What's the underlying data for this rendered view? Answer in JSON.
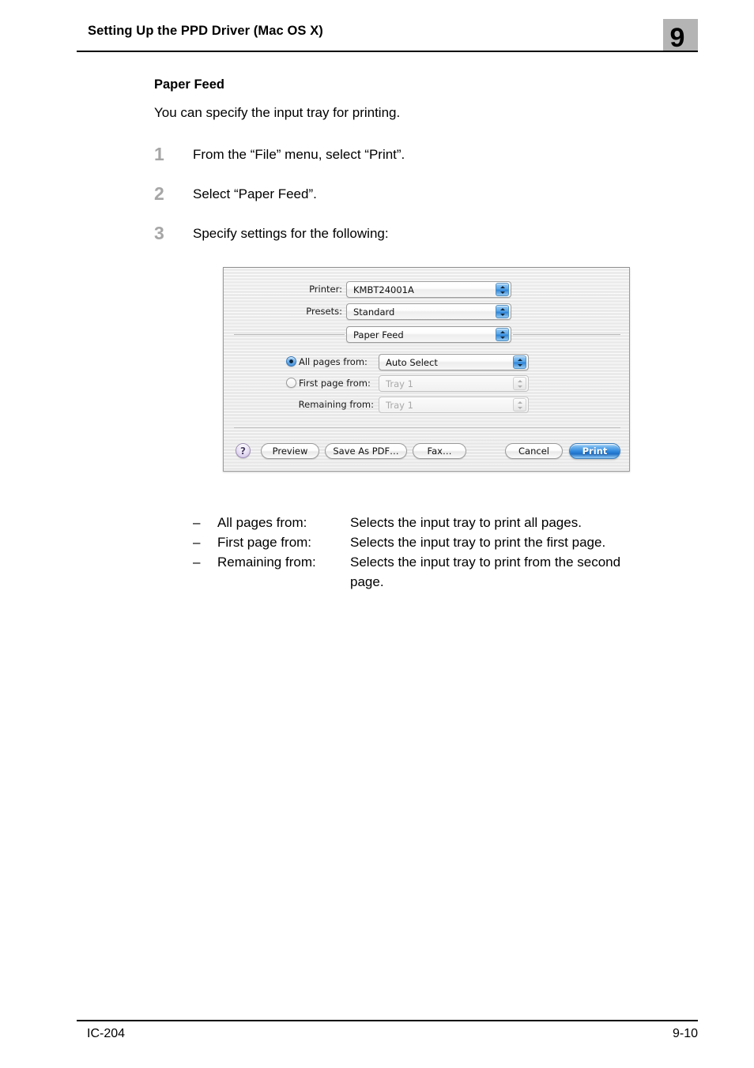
{
  "header": {
    "title": "Setting Up the PPD Driver (Mac OS X)",
    "chapter": "9"
  },
  "body": {
    "section_heading": "Paper Feed",
    "intro": "You can specify the input tray for printing.",
    "steps": [
      {
        "num": "1",
        "text": "From the “File” menu, select “Print”."
      },
      {
        "num": "2",
        "text": "Select “Paper Feed”."
      },
      {
        "num": "3",
        "text": "Specify settings for the following:"
      }
    ]
  },
  "dialog": {
    "printer_label": "Printer:",
    "printer_value": "KMBT24001A",
    "presets_label": "Presets:",
    "presets_value": "Standard",
    "pane_value": "Paper Feed",
    "all_pages_label": "All pages from:",
    "all_pages_value": "Auto Select",
    "first_page_label": "First page from:",
    "first_page_value": "Tray 1",
    "remaining_label": "Remaining from:",
    "remaining_value": "Tray 1",
    "help_label": "?",
    "preview_label": "Preview",
    "save_pdf_label": "Save As PDF…",
    "fax_label": "Fax…",
    "cancel_label": "Cancel",
    "print_label": "Print",
    "accent_blue": "#2f88dd",
    "selected_radio": "all_pages"
  },
  "definitions": [
    {
      "dash": "–",
      "term": "All pages from:",
      "desc": "Selects the input tray to print all pages.",
      "cont": ""
    },
    {
      "dash": "–",
      "term": "First page from:",
      "desc": "Selects the input tray to print the first page.",
      "cont": ""
    },
    {
      "dash": "–",
      "term": "Remaining from:",
      "desc": "Selects the input tray to print from the second",
      "cont": "page."
    }
  ],
  "footer": {
    "left": "IC-204",
    "right": "9-10"
  }
}
